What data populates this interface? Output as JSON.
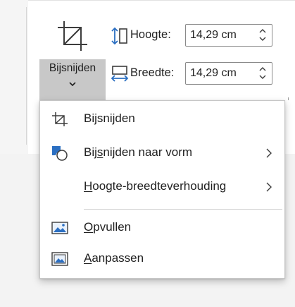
{
  "ribbon": {
    "crop_split_button": {
      "label": "Bijsnijden",
      "big_icon": "crop-icon",
      "dropdown_icon": "chevron-down-icon"
    },
    "height": {
      "label": "Hoogte:",
      "value": "14,29 cm",
      "icon": "shape-height-icon"
    },
    "width": {
      "label": "Breedte:",
      "value": "14,29 cm",
      "icon": "shape-width-icon"
    }
  },
  "menu": {
    "items": [
      {
        "prefix": "Bi",
        "access_key": "j",
        "suffix": "snijden",
        "icon": "crop-icon",
        "submenu": false
      },
      {
        "prefix": "Bij",
        "access_key": "s",
        "suffix": "nijden naar vorm",
        "icon": "crop-to-shape-icon",
        "submenu": true
      },
      {
        "prefix": "",
        "access_key": "H",
        "suffix": "oogte-breedteverhouding",
        "icon": "",
        "submenu": true
      },
      {
        "prefix": "",
        "access_key": "O",
        "suffix": "pvullen",
        "icon": "fill-picture-icon",
        "submenu": false
      },
      {
        "prefix": "",
        "access_key": "A",
        "suffix": "anpassen",
        "icon": "fit-picture-icon",
        "submenu": false
      }
    ]
  },
  "colors": {
    "accent_blue": "#2b6fc2",
    "icon_dark": "#3c3c3c",
    "split_button_bg": "#c8c8c8"
  }
}
